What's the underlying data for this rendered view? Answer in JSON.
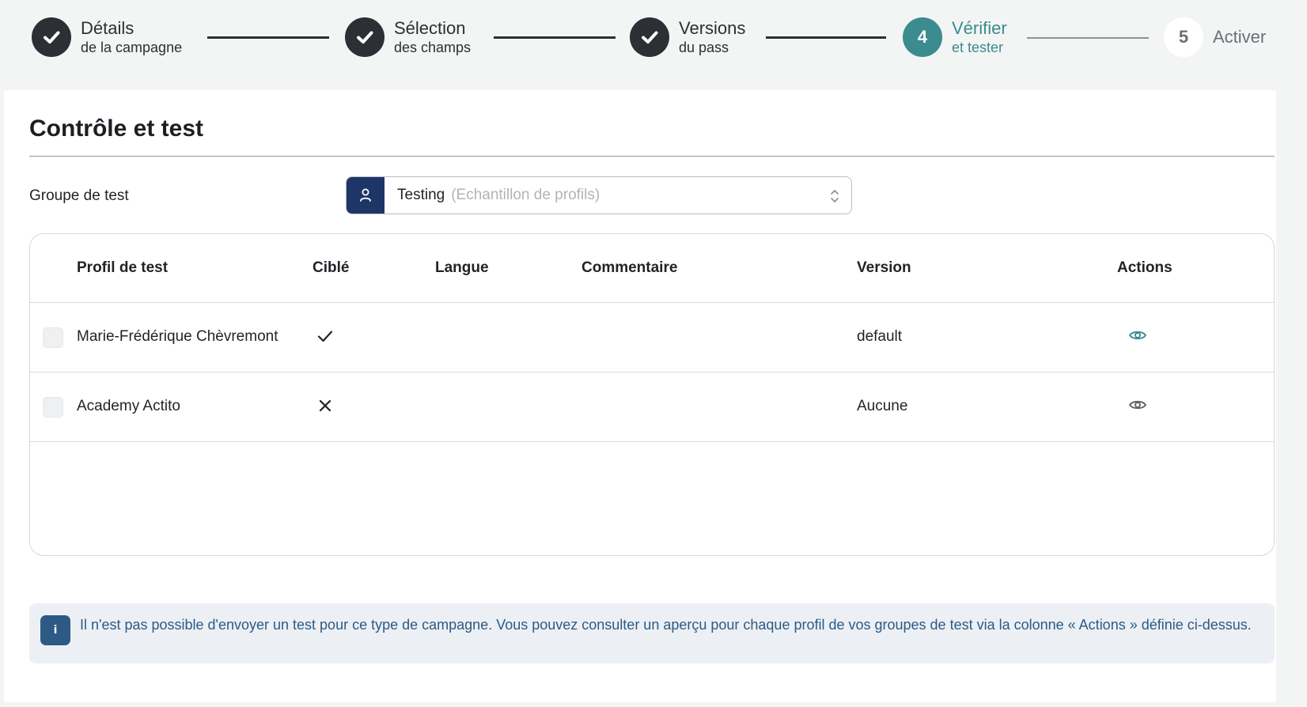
{
  "stepper": {
    "steps": [
      {
        "title": "Détails",
        "sub": "de la campagne",
        "state": "done"
      },
      {
        "title": "Sélection",
        "sub": "des champs",
        "state": "done"
      },
      {
        "title": "Versions",
        "sub": "du pass",
        "state": "done"
      },
      {
        "number": "4",
        "title": "Vérifier",
        "sub": "et tester",
        "state": "active"
      },
      {
        "number": "5",
        "title": "Activer",
        "state": "pending"
      }
    ]
  },
  "section": {
    "title": "Contrôle et test"
  },
  "test_group": {
    "label": "Groupe de test",
    "value": "Testing",
    "hint": "(Echantillon de profils)"
  },
  "table": {
    "headers": {
      "profile": "Profil de test",
      "targeted": "Ciblé",
      "language": "Langue",
      "comment": "Commentaire",
      "version": "Version",
      "actions": "Actions"
    },
    "rows": [
      {
        "profile": "Marie-Frédérique Chèvremont",
        "targeted": true,
        "language": "",
        "comment": "",
        "version": "default",
        "eye_color": "#3b8b8f"
      },
      {
        "profile": "Academy Actito",
        "targeted": false,
        "language": "",
        "comment": "",
        "version": "Aucune",
        "eye_color": "#5f646a"
      }
    ]
  },
  "info": {
    "icon": "info-icon",
    "text": "Il n'est pas possible d'envoyer un test pour ce type de campagne. Vous pouvez consulter un aperçu pour chaque profil de vos groupes de test via la colonne « Actions » définie ci-dessus."
  },
  "colors": {
    "accent": "#3b8b8f",
    "dark": "#2c2f33",
    "navy": "#1e3568",
    "info_text": "#2c5a85"
  }
}
